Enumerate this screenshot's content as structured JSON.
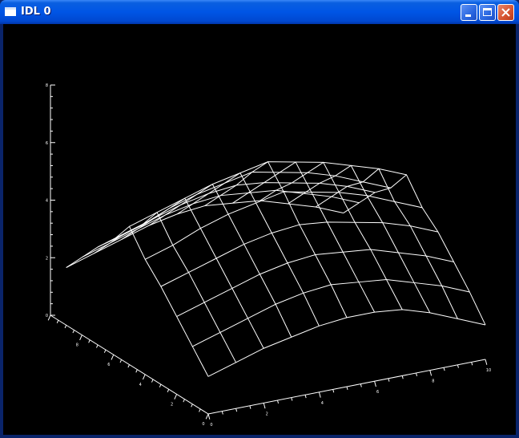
{
  "window": {
    "title": "IDL 0"
  },
  "chart_data": {
    "type": "surface",
    "grid_size": 10,
    "z_axis": {
      "ticks": [
        "0",
        "2",
        "4",
        "6",
        "8"
      ],
      "range": [
        0,
        8
      ]
    },
    "y_axis": {
      "ticks": [
        "0",
        "2",
        "4",
        "6",
        "8"
      ],
      "range": [
        0,
        9
      ]
    },
    "x_axis": {
      "ticks": [
        "0",
        "2",
        "4",
        "6",
        "8",
        "10"
      ],
      "range": [
        0,
        10
      ]
    },
    "z_values": [
      [
        1.3,
        1.6,
        1.9,
        2.1,
        2.3,
        2.4,
        2.4,
        2.3,
        2.0,
        1.6,
        1.2
      ],
      [
        2.0,
        2.3,
        2.6,
        2.9,
        3.1,
        3.2,
        3.1,
        3.0,
        2.7,
        2.4,
        2.0
      ],
      [
        2.7,
        3.0,
        3.3,
        3.6,
        3.8,
        3.9,
        3.8,
        3.7,
        3.4,
        3.1,
        2.7
      ],
      [
        3.4,
        3.7,
        4.0,
        4.3,
        4.5,
        4.6,
        4.5,
        4.3,
        4.1,
        3.8,
        3.4
      ],
      [
        4.0,
        4.3,
        4.7,
        5.0,
        5.2,
        5.4,
        5.2,
        5.0,
        4.7,
        4.3,
        3.9
      ],
      [
        4.8,
        5.1,
        5.4,
        5.7,
        5.9,
        6.1,
        5.9,
        5.7,
        5.4,
        5.1,
        4.7
      ],
      [
        4.0,
        4.3,
        4.7,
        5.0,
        5.2,
        5.4,
        5.2,
        5.0,
        4.7,
        4.3,
        3.9
      ],
      [
        3.4,
        3.7,
        4.0,
        4.3,
        4.5,
        4.6,
        4.5,
        4.3,
        4.1,
        3.8,
        3.4
      ],
      [
        2.7,
        3.0,
        3.3,
        3.6,
        3.8,
        3.9,
        3.8,
        3.7,
        3.4,
        3.1,
        2.7
      ],
      [
        2.0,
        2.3,
        2.6,
        2.9,
        3.1,
        3.2,
        3.1,
        3.0,
        2.7,
        2.4,
        2.0
      ]
    ]
  }
}
